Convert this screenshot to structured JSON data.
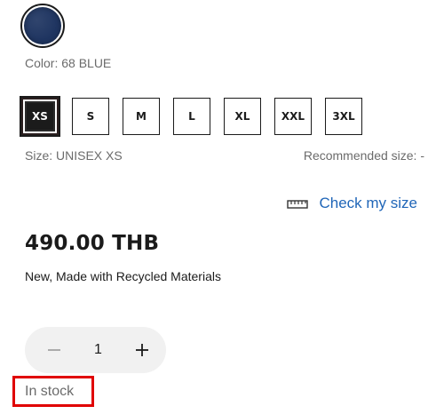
{
  "color": {
    "label": "Color: 68 BLUE",
    "swatch_hex": "#1f3561",
    "selected": true
  },
  "sizes": {
    "options": [
      {
        "label": "XS",
        "selected": true
      },
      {
        "label": "S",
        "selected": false
      },
      {
        "label": "M",
        "selected": false
      },
      {
        "label": "L",
        "selected": false
      },
      {
        "label": "XL",
        "selected": false
      },
      {
        "label": "XXL",
        "selected": false
      },
      {
        "label": "3XL",
        "selected": false
      }
    ],
    "size_label": "Size: UNISEX XS",
    "recommended_label": "Recommended size: -"
  },
  "check_size": {
    "label": "Check my size",
    "icon": "ruler-icon",
    "link_color": "#2066b8"
  },
  "price": {
    "text": "490.00 THB",
    "tagline": "New, Made with Recycled Materials"
  },
  "quantity": {
    "value": "1",
    "decrement_icon": "minus-icon",
    "increment_icon": "plus-icon"
  },
  "stock": {
    "text": "In stock",
    "highlight_color": "#e00000"
  }
}
